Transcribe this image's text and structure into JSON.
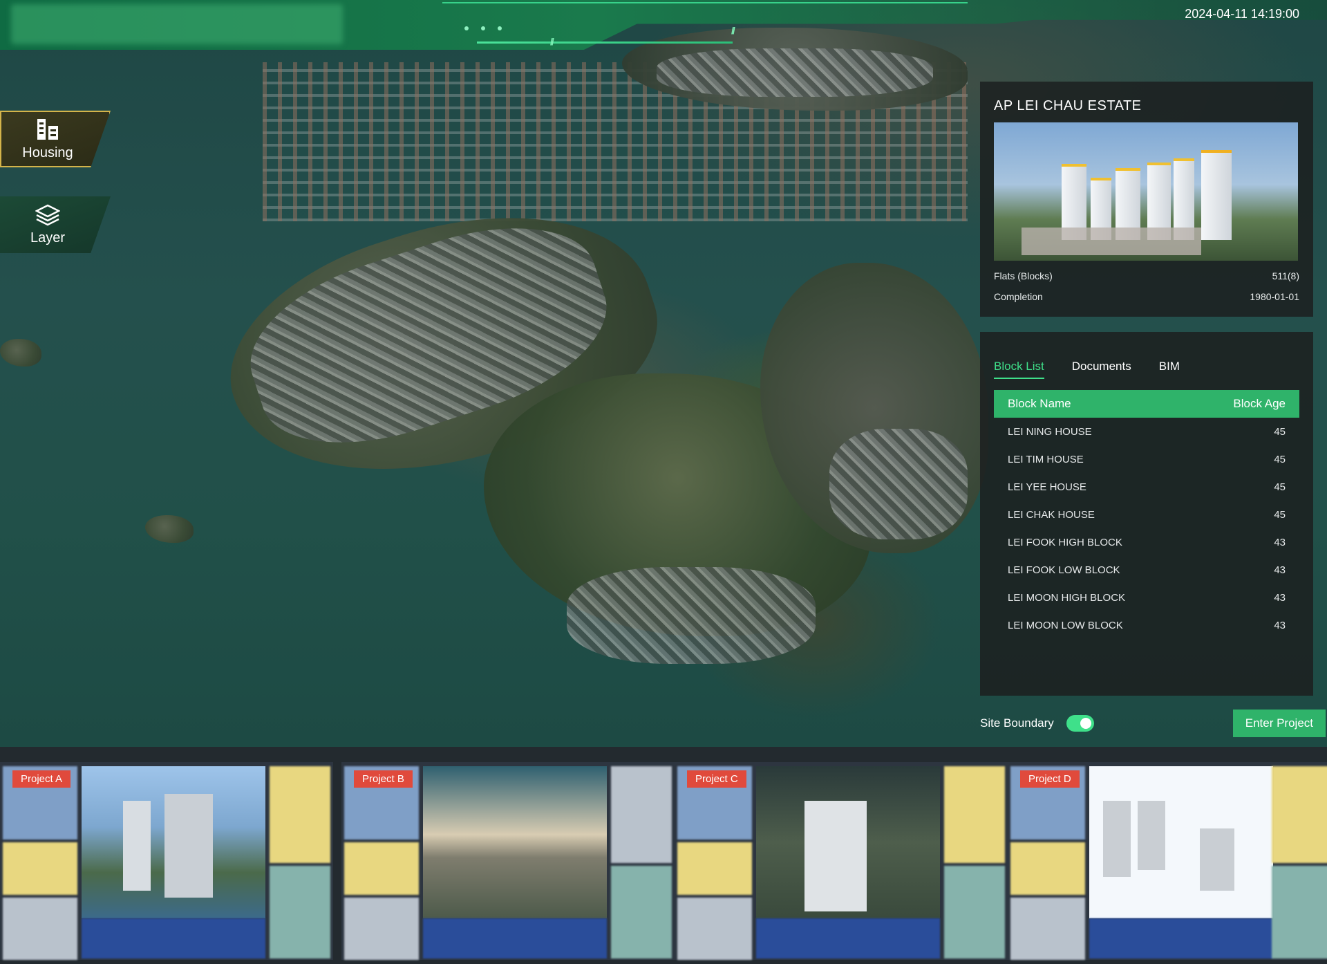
{
  "header": {
    "datetime": "2024-04-11 14:19:00"
  },
  "sidebar": {
    "housing_label": "Housing",
    "layer_label": "Layer"
  },
  "estate": {
    "title": "AP LEI CHAU ESTATE",
    "flats_label": "Flats (Blocks)",
    "flats_value": "511(8)",
    "completion_label": "Completion",
    "completion_value": "1980-01-01"
  },
  "tabs": [
    "Block List",
    "Documents",
    "BIM"
  ],
  "table": {
    "headers": [
      "Block Name",
      "Block Age"
    ],
    "rows": [
      {
        "name": "LEI NING HOUSE",
        "age": "45"
      },
      {
        "name": "LEI TIM HOUSE",
        "age": "45"
      },
      {
        "name": "LEI YEE HOUSE",
        "age": "45"
      },
      {
        "name": "LEI CHAK HOUSE",
        "age": "45"
      },
      {
        "name": "LEI FOOK HIGH BLOCK",
        "age": "43"
      },
      {
        "name": "LEI FOOK LOW BLOCK",
        "age": "43"
      },
      {
        "name": "LEI MOON HIGH BLOCK",
        "age": "43"
      },
      {
        "name": "LEI MOON LOW BLOCK",
        "age": "43"
      }
    ]
  },
  "controls": {
    "site_boundary_label": "Site Boundary",
    "site_boundary_on": true,
    "enter_label": "Enter Project"
  },
  "projects": [
    "Project A",
    "Project B",
    "Project C",
    "Project D"
  ],
  "colors": {
    "accent": "#2fb36a",
    "tab_active": "#3fe08a",
    "tag": "#e04a3c"
  }
}
